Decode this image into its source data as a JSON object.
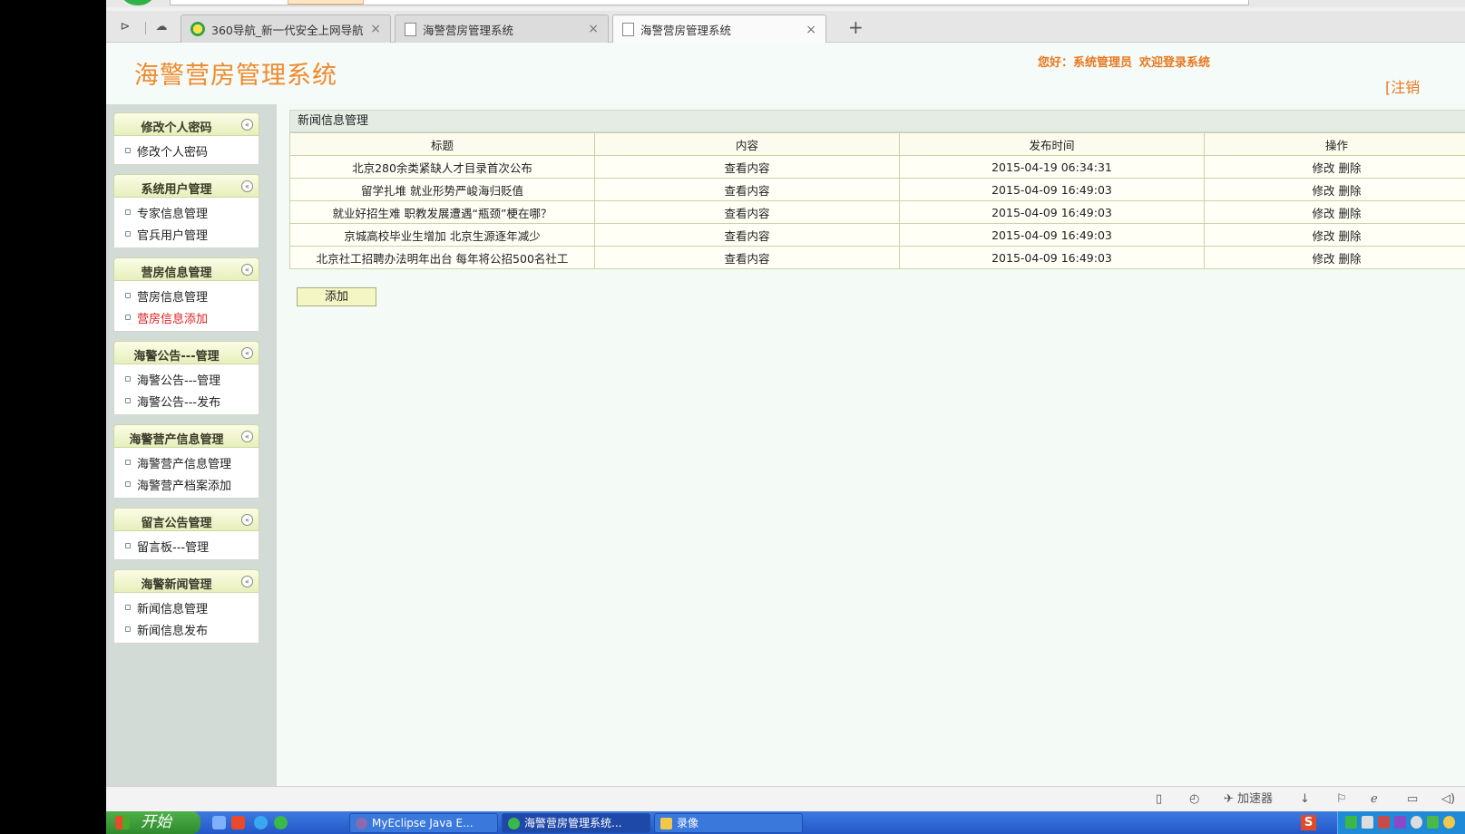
{
  "browser": {
    "tabs": [
      {
        "label": "360导航_新一代安全上网导航",
        "close": "×"
      },
      {
        "label": "海警营房管理系统",
        "close": "×"
      },
      {
        "label": "海警营房管理系统",
        "close": "×"
      }
    ],
    "new_tab": "+"
  },
  "header": {
    "title": "海警营房管理系统",
    "greeting": "您好：系统管理员",
    "welcome": "欢迎登录系统",
    "logout": "[注销"
  },
  "sidebar": {
    "toggle_glyph": "«",
    "groups": [
      {
        "title": "修改个人密码",
        "items": [
          "修改个人密码"
        ]
      },
      {
        "title": "系统用户管理",
        "items": [
          "专家信息管理",
          "官兵用户管理"
        ]
      },
      {
        "title": "营房信息管理",
        "items": [
          "营房信息管理",
          "营房信息添加"
        ]
      },
      {
        "title": "海警公告---管理",
        "items": [
          "海警公告---管理",
          "海警公告---发布"
        ]
      },
      {
        "title": "海警营产信息管理",
        "items": [
          "海警营产信息管理",
          "海警营产档案添加"
        ]
      },
      {
        "title": "留言公告管理",
        "items": [
          "留言板---管理"
        ]
      },
      {
        "title": "海警新闻管理",
        "items": [
          "新闻信息管理",
          "新闻信息发布"
        ]
      }
    ]
  },
  "main": {
    "panel_title": "新闻信息管理",
    "columns": [
      "标题",
      "内容",
      "发布时间",
      "操作"
    ],
    "rows": [
      {
        "title": "北京280余类紧缺人才目录首次公布",
        "content": "查看内容",
        "time": "2015-04-19 06:34:31",
        "edit": "修改",
        "delete": "删除"
      },
      {
        "title": "留学扎堆 就业形势严峻海归贬值",
        "content": "查看内容",
        "time": "2015-04-09 16:49:03",
        "edit": "修改",
        "delete": "删除"
      },
      {
        "title": "就业好招生难 职教发展遭遇“瓶颈”梗在哪？",
        "content": "查看内容",
        "time": "2015-04-09 16:49:03",
        "edit": "修改",
        "delete": "删除"
      },
      {
        "title": "京城高校毕业生增加 北京生源逐年减少",
        "content": "查看内容",
        "time": "2015-04-09 16:49:03",
        "edit": "修改",
        "delete": "删除"
      },
      {
        "title": "北京社工招聘办法明年出台 每年将公招500名社工",
        "content": "查看内容",
        "time": "2015-04-09 16:49:03",
        "edit": "修改",
        "delete": "删除"
      }
    ],
    "add_button": "添加"
  },
  "statusbar": {
    "accelerator": "加速器"
  },
  "taskbar": {
    "start": "开始",
    "tasks": [
      "MyEclipse Java E...",
      "海警营房管理系统...",
      "录像"
    ],
    "ime": "S"
  }
}
